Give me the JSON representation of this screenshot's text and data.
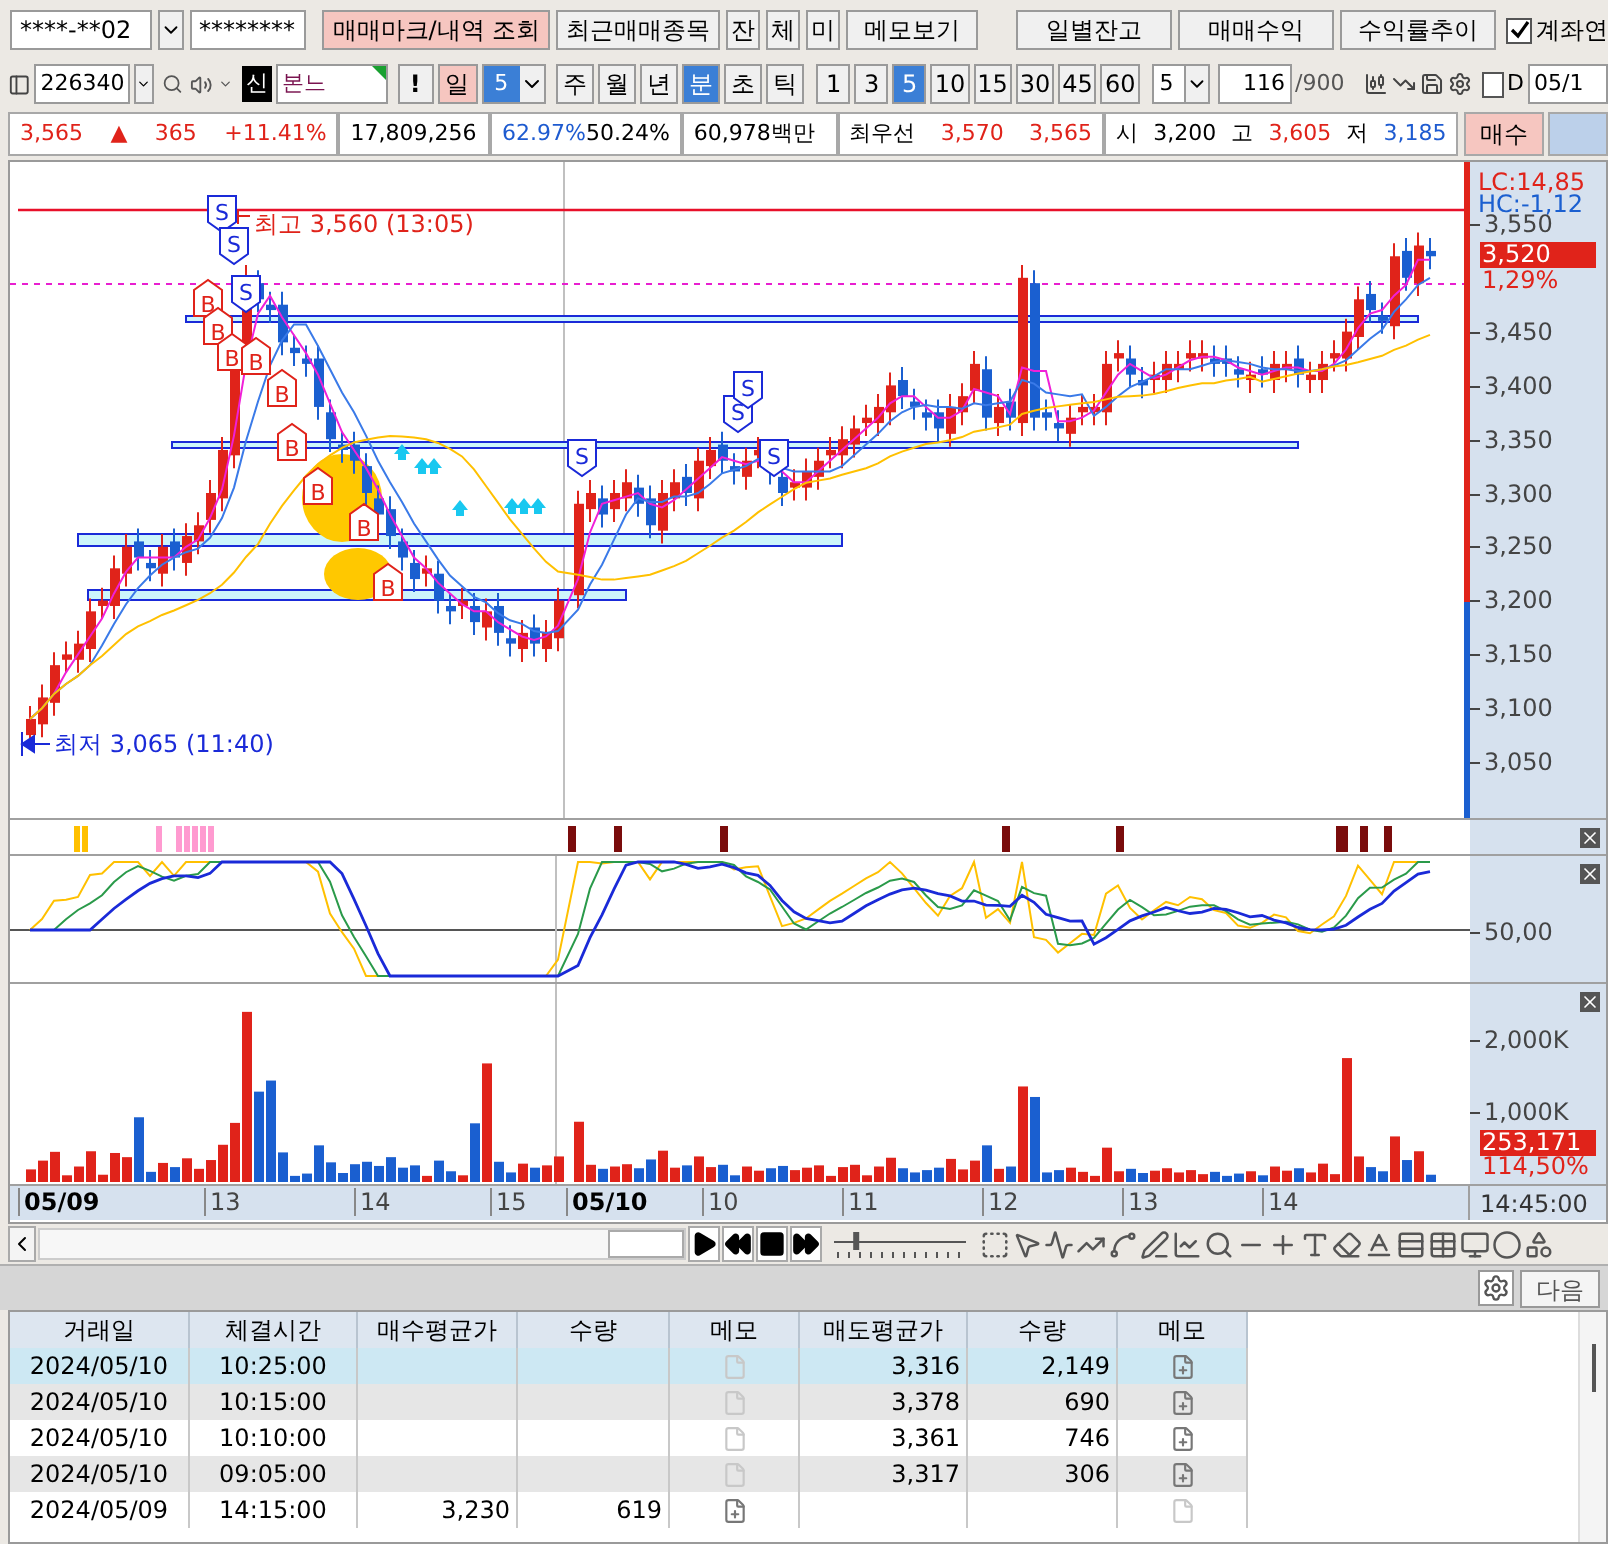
{
  "top_toolbar": {
    "account": "****-**02",
    "password": "********",
    "buttons": [
      {
        "label": "매매마크/내역 조회",
        "selected": true
      },
      {
        "label": "최근매매종목",
        "selected": false
      },
      {
        "label": "잔",
        "selected": false
      },
      {
        "label": "체",
        "selected": false
      },
      {
        "label": "미",
        "selected": false
      },
      {
        "label": "메모보기",
        "selected": false
      }
    ],
    "report_buttons": [
      "일별잔고",
      "매매수익",
      "수익률추이"
    ],
    "account_checkbox": {
      "label": "계좌연",
      "checked": true
    }
  },
  "chart_toolbar": {
    "code": "226340",
    "credit_badge": "신",
    "stock_name": "본느",
    "alert_button": "!",
    "day_button": {
      "label": "일",
      "selected": true
    },
    "day_count": "5",
    "periods": [
      {
        "label": "주",
        "selected": false
      },
      {
        "label": "월",
        "selected": false
      },
      {
        "label": "년",
        "selected": false
      },
      {
        "label": "분",
        "selected": true
      },
      {
        "label": "초",
        "selected": false
      },
      {
        "label": "틱",
        "selected": false
      }
    ],
    "intervals": [
      {
        "label": "1",
        "selected": false
      },
      {
        "label": "3",
        "selected": false
      },
      {
        "label": "5",
        "selected": true
      },
      {
        "label": "10",
        "selected": false
      },
      {
        "label": "15",
        "selected": false
      },
      {
        "label": "30",
        "selected": false
      },
      {
        "label": "45",
        "selected": false
      },
      {
        "label": "60",
        "selected": false
      }
    ],
    "interval_count": "5",
    "bar_count": "116",
    "bar_max": "/900",
    "d_checkbox": {
      "label": "D",
      "checked": false
    },
    "date": "05/1"
  },
  "quote_bar": {
    "cells": [
      [
        {
          "text": "3,565",
          "color": "#e0231a"
        },
        {
          "text": "▲",
          "color": "#e0231a"
        },
        {
          "text": "365",
          "color": "#e0231a"
        },
        {
          "text": "+11.41%",
          "color": "#e0231a"
        }
      ],
      [
        {
          "text": "17,809,256",
          "color": "#000000"
        }
      ],
      [
        {
          "text": "62.97%",
          "color": "#1e5bd0"
        },
        {
          "text": "50.24%",
          "color": "#000000"
        }
      ],
      [
        {
          "text": "60,978백만",
          "color": "#000000"
        }
      ],
      [
        {
          "text": "최우선",
          "color": "#000000"
        },
        {
          "text": "3,570",
          "color": "#e0231a"
        },
        {
          "text": "3,565",
          "color": "#e0231a"
        }
      ],
      [
        {
          "text": "시",
          "color": "#000000"
        },
        {
          "text": "3,200",
          "color": "#000000"
        },
        {
          "text": "고",
          "color": "#000000"
        },
        {
          "text": "3,605",
          "color": "#e0231a"
        },
        {
          "text": "저",
          "color": "#000000"
        },
        {
          "text": "3,185",
          "color": "#1e5bd0"
        }
      ]
    ],
    "buy_button": "매수"
  },
  "chart": {
    "high_label": "최고 3,560 (13:05)",
    "low_label": "최저 3,065 (11:40)",
    "lc": "LC:14,85",
    "hc": "HC:-1,12",
    "price_tag": "3,520",
    "price_change": "1,29%",
    "price_axis": [
      "3,550",
      "3,450",
      "3,400",
      "3,350",
      "3,300",
      "3,250",
      "3,200",
      "3,150",
      "3,100",
      "3,050"
    ],
    "markers": [
      {
        "kind": "sell",
        "label": "S"
      },
      {
        "kind": "sell",
        "label": "S"
      },
      {
        "kind": "sell",
        "label": "S"
      },
      {
        "kind": "sell",
        "label": "S"
      },
      {
        "kind": "sell",
        "label": "S"
      },
      {
        "kind": "sell",
        "label": "S"
      },
      {
        "kind": "sell",
        "label": "S"
      },
      {
        "kind": "buy",
        "label": "B"
      },
      {
        "kind": "buy",
        "label": "B"
      },
      {
        "kind": "buy",
        "label": "B"
      },
      {
        "kind": "buy",
        "label": "B"
      },
      {
        "kind": "buy",
        "label": "B"
      },
      {
        "kind": "buy",
        "label": "B"
      },
      {
        "kind": "buy",
        "label": "B"
      },
      {
        "kind": "buy",
        "label": "B"
      },
      {
        "kind": "buy",
        "label": "B"
      }
    ],
    "oscillator_axis": "50,00",
    "volume_axis": [
      "2,000K",
      "1,000K"
    ],
    "volume_tag": "253,171",
    "volume_ratio": "114,50%",
    "time_axis": [
      {
        "label": "05/09",
        "kind": "date"
      },
      {
        "label": "13",
        "kind": "hour"
      },
      {
        "label": "14",
        "kind": "hour"
      },
      {
        "label": "15",
        "kind": "hour"
      },
      {
        "label": "05/10",
        "kind": "date"
      },
      {
        "label": "10",
        "kind": "hour"
      },
      {
        "label": "11",
        "kind": "hour"
      },
      {
        "label": "12",
        "kind": "hour"
      },
      {
        "label": "13",
        "kind": "hour"
      },
      {
        "label": "14",
        "kind": "hour"
      }
    ],
    "time_end": "14:45:00"
  },
  "zoom_slider": {
    "level": 0.15
  },
  "bottom_panel": {
    "next_button": "다음"
  },
  "table": {
    "columns": [
      "거래일",
      "체결시간",
      "매수평균가",
      "수량",
      "메모",
      "매도평균가",
      "수량",
      "메모"
    ],
    "rows": [
      {
        "date": "2024/05/10",
        "time": "10:25:00",
        "buy_memo_added": false,
        "sell_avg": "3,316",
        "sell_qty": "2,149",
        "sell_memo_added": true,
        "selected": true
      },
      {
        "date": "2024/05/10",
        "time": "10:15:00",
        "buy_memo_added": false,
        "sell_avg": "3,378",
        "sell_qty": "690",
        "sell_memo_added": true,
        "selected": false
      },
      {
        "date": "2024/05/10",
        "time": "10:10:00",
        "buy_memo_added": false,
        "sell_avg": "3,361",
        "sell_qty": "746",
        "sell_memo_added": true,
        "selected": false
      },
      {
        "date": "2024/05/10",
        "time": "09:05:00",
        "buy_memo_added": false,
        "sell_avg": "3,317",
        "sell_qty": "306",
        "sell_memo_added": true,
        "selected": false
      },
      {
        "date": "2024/05/09",
        "time": "14:15:00",
        "buy_avg": "3,230",
        "buy_qty": "619",
        "buy_memo_added": true,
        "sell_memo_added": false,
        "selected": false
      }
    ]
  }
}
